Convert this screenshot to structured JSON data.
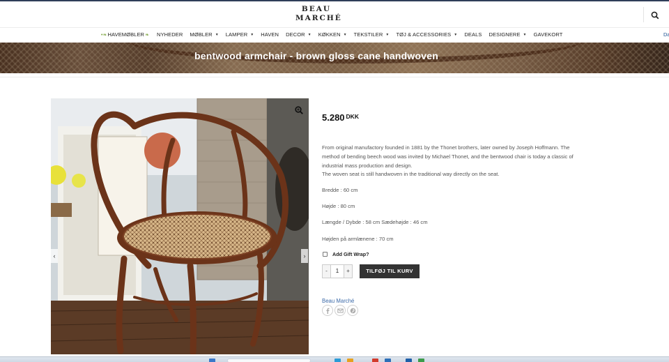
{
  "header": {
    "logo_line1": "BEAU",
    "logo_line2": "MARCHÉ"
  },
  "nav": {
    "items": [
      {
        "label": "HAVEMØBLER",
        "leaves": true
      },
      {
        "label": "NYHEDER"
      },
      {
        "label": "MØBLER",
        "caret": true
      },
      {
        "label": "LAMPER",
        "caret": true
      },
      {
        "label": "HAVEN"
      },
      {
        "label": "DECOR",
        "caret": true
      },
      {
        "label": "KØKKEN",
        "caret": true
      },
      {
        "label": "TEKSTILER",
        "caret": true
      },
      {
        "label": "TØJ & ACCESSORIES",
        "caret": true
      },
      {
        "label": "DEALS"
      },
      {
        "label": "DESIGNERE",
        "caret": true
      },
      {
        "label": "GAVEKORT"
      }
    ],
    "cut_text": "Da"
  },
  "banner": {
    "title": "bentwood armchair - brown gloss cane handwoven"
  },
  "product": {
    "price": "5.280",
    "currency": "DKK",
    "description": "From original manufactory founded in 1881 by the Thonet brothers, later owned by Joseph Hoffmann. The method of bending beech wood was invited by Michael Thonet, and the bentwood chair is today a classic of industrial mass production and design.",
    "description2": "The woven seat is still handwoven in the traditional way directly on the seat.",
    "specs": {
      "width": "Bredde : 60 cm",
      "height": "Højde : 80 cm",
      "length": "Længde / Dybde : 58 cm Sædehøjde : 46 cm",
      "armrest": "Højden på armlænene : 70 cm"
    },
    "gift_wrap_label": "Add Gift Wrap?",
    "quantity": "1",
    "minus_label": "-",
    "plus_label": "+",
    "add_to_cart_label": "TILFØJ TIL KURV",
    "brand": "Beau Marché"
  },
  "gallery": {
    "prev_label": "‹",
    "next_label": "›"
  },
  "colors": {
    "accent_dark": "#333333",
    "link": "#3c6aa8",
    "top_line": "#2f3d59"
  },
  "icons": [
    "search-icon",
    "zoom-icon",
    "facebook-icon",
    "email-icon",
    "pinterest-icon"
  ]
}
